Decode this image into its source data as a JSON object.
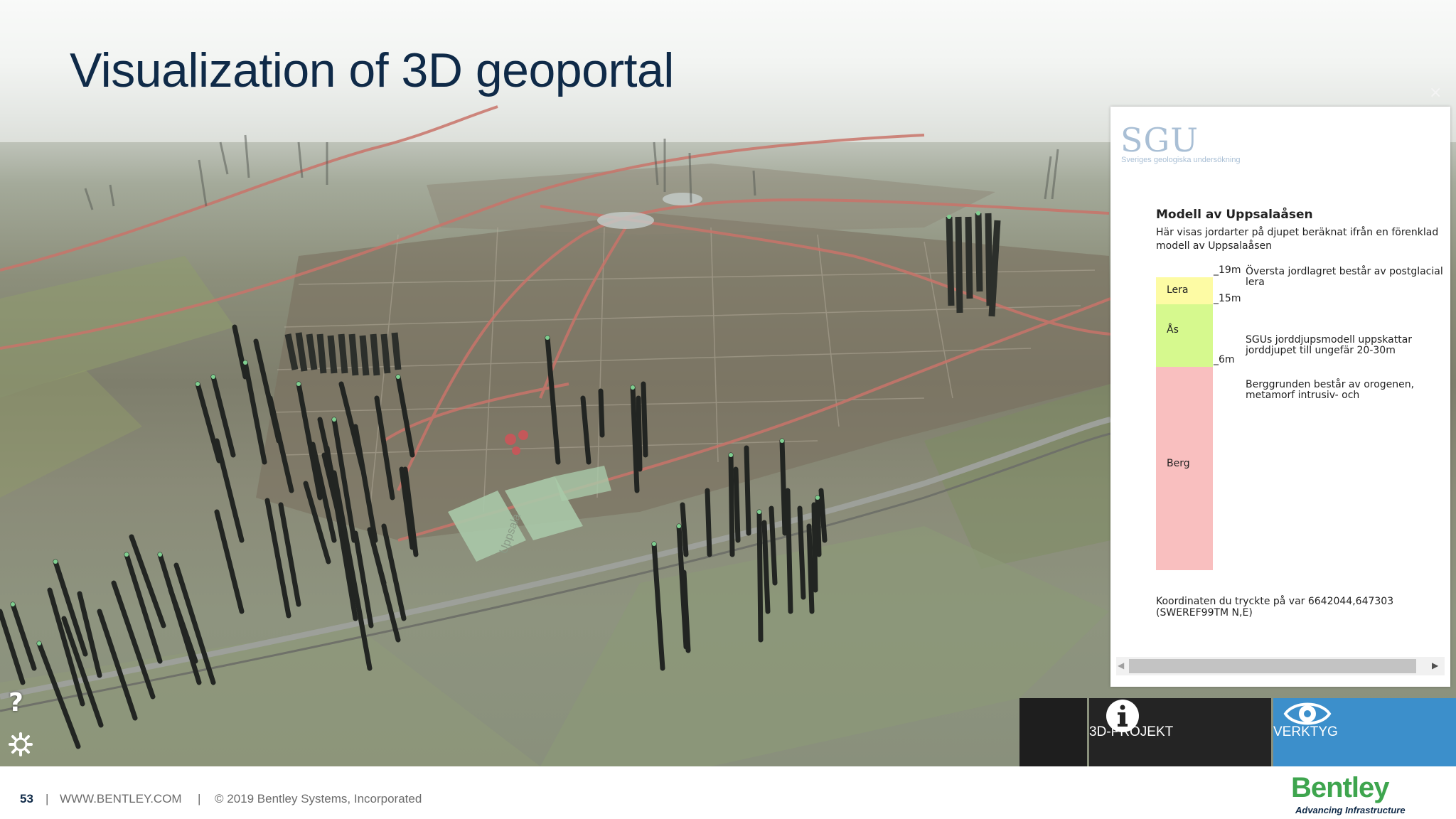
{
  "slide": {
    "title": "Visualization of 3D geoportal"
  },
  "scene": {
    "help_label": "?",
    "area_label": "Uppsala"
  },
  "panel": {
    "close_label": "×",
    "logo_text": "SGU",
    "logo_subtitle": "Sveriges geologiska undersökning",
    "model_title": "Modell av Uppsalaåsen",
    "model_description": "Här visas jordarter på djupet beräknat ifrån en förenklad modell av Uppsalaåsen",
    "layers": [
      {
        "name": "Lera",
        "color": "#fdfba4"
      },
      {
        "name": "Ås",
        "color": "#d6f98e"
      },
      {
        "name": "Berg",
        "color": "#f9bfbf"
      }
    ],
    "depths": [
      "19m",
      "15m",
      "6m"
    ],
    "notes": [
      "Översta jordlagret består av postglacial lera",
      "SGUs jorddjupsmodell uppskattar jorddjupet till ungefär 20-30m",
      "Berggrunden består av orogenen, metamorf intrusiv- och"
    ],
    "coordinate_text": "Koordinaten du tryckte på var 6642044,647303 (SWEREF99TM N,E)"
  },
  "toolbar": {
    "projekt_label": "3D-PROJEKT",
    "verktyg_label": "VERKTYG",
    "active_color": "#3c8fcb"
  },
  "footer": {
    "page_number": "53",
    "separator": "|",
    "website": "WWW.BENTLEY.COM",
    "copyright": "©  2019 Bentley Systems, Incorporated",
    "brand": "Bentley",
    "tagline": "Advancing Infrastructure",
    "brand_color": "#3ea54e"
  }
}
